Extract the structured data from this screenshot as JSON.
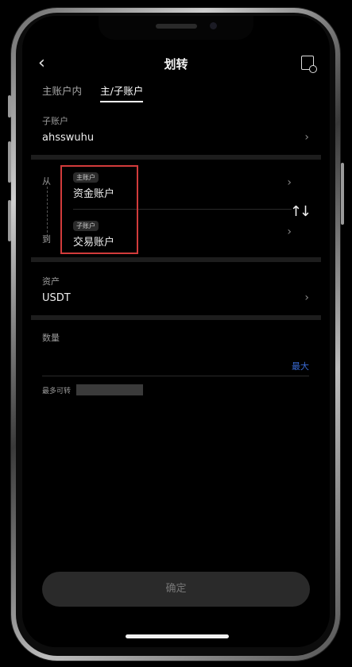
{
  "header": {
    "title": "划转",
    "back_icon": "chevron-left-icon",
    "history_icon": "history-icon"
  },
  "tabs": [
    {
      "label": "主账户内"
    },
    {
      "label": "主/子账户"
    }
  ],
  "sub_account": {
    "label": "子账户",
    "value": "ahsswuhu"
  },
  "transfer": {
    "from_label": "从",
    "to_label": "到",
    "from": {
      "badge": "主账户",
      "account": "资金账户"
    },
    "to": {
      "badge": "子账户",
      "account": "交易账户"
    },
    "swap_icon": "swap-vertical-icon"
  },
  "asset": {
    "label": "资产",
    "value": "USDT"
  },
  "amount": {
    "label": "数量",
    "max_label": "最大",
    "available_label": "最多可转"
  },
  "confirm_label": "确定",
  "colors": {
    "accent": "#3a6bd6",
    "highlight_box": "#d23b3b"
  }
}
